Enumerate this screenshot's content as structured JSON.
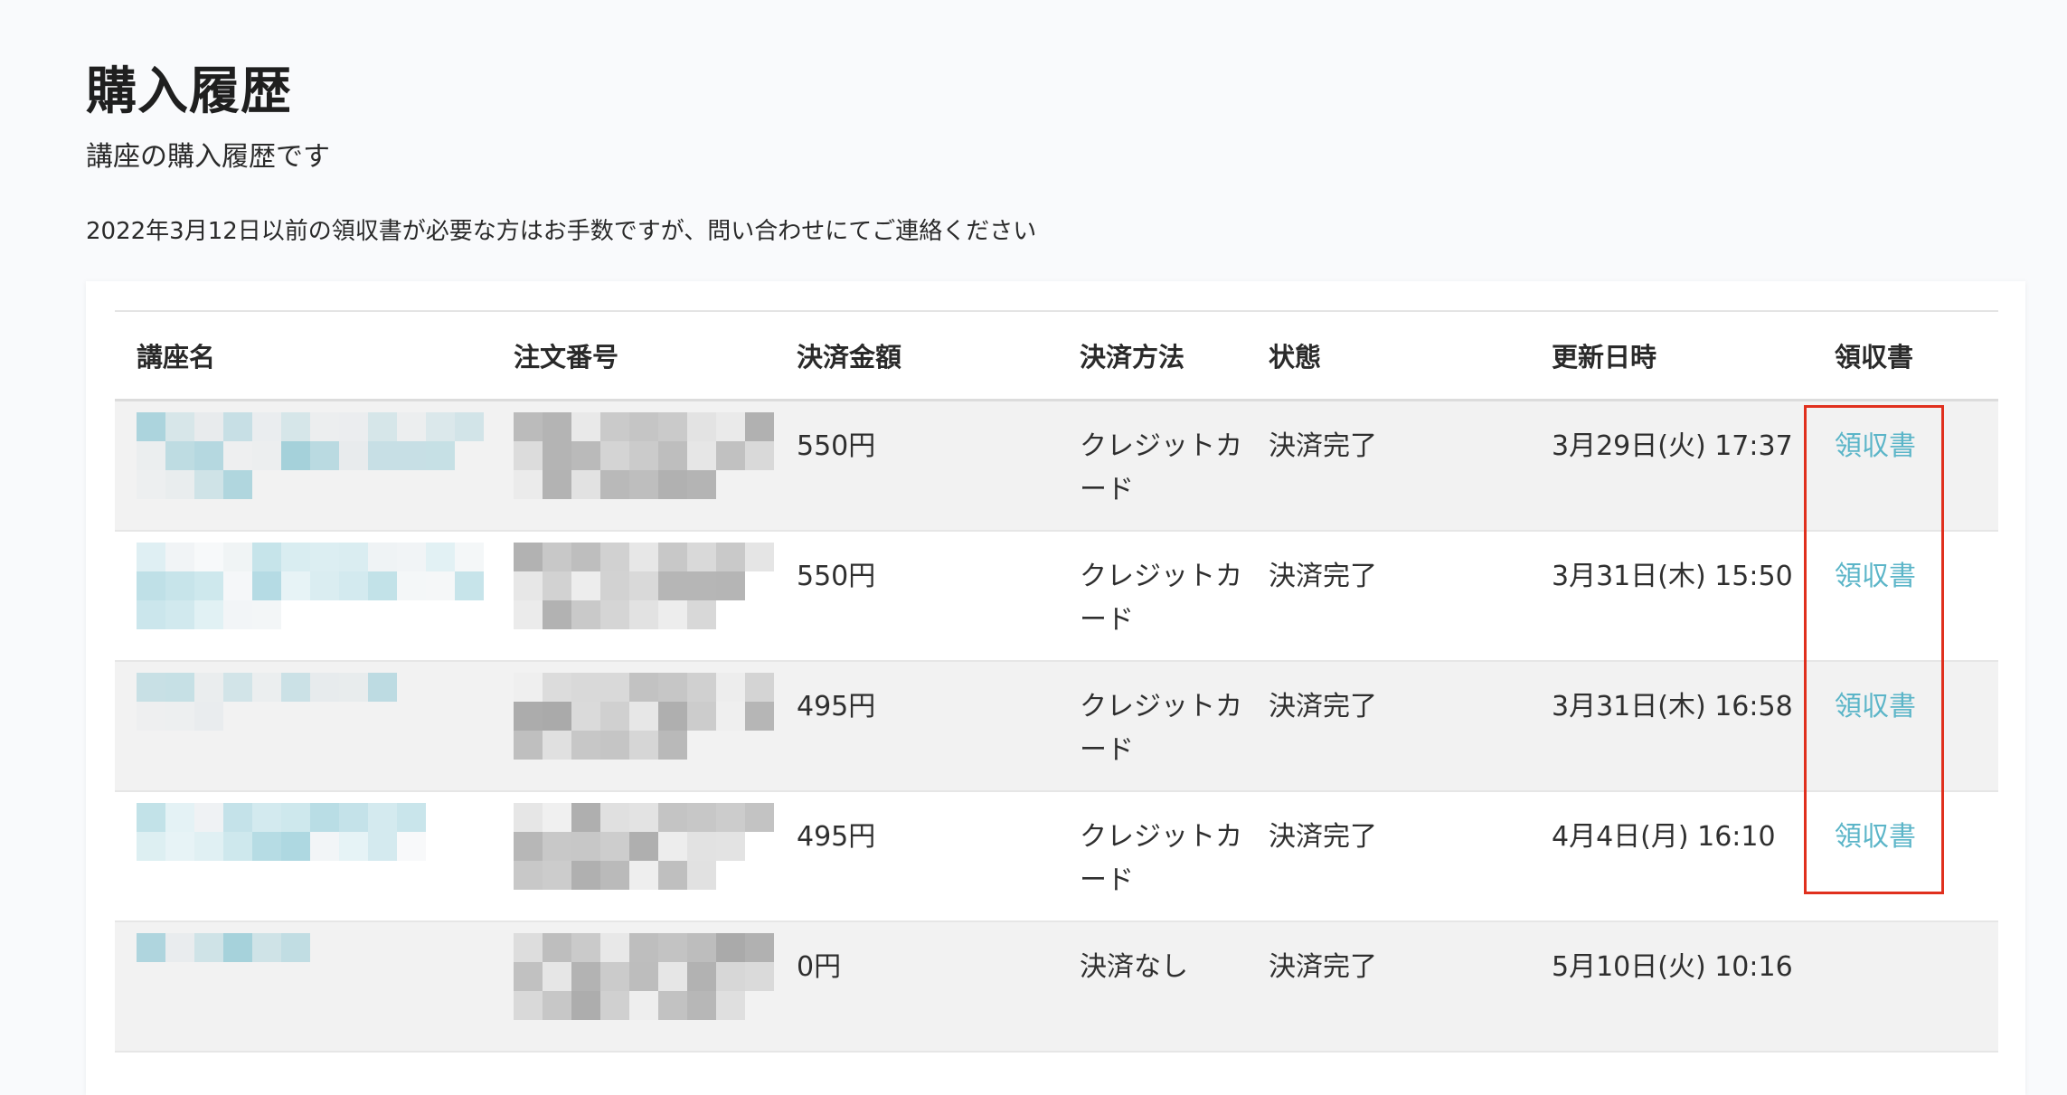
{
  "header": {
    "title": "購入履歴",
    "subtitle": "講座の購入履歴です",
    "notice": "2022年3月12日以前の領収書が必要な方はお手数ですが、問い合わせにてご連絡ください"
  },
  "table": {
    "columns": [
      "講座名",
      "注文番号",
      "決済金額",
      "決済方法",
      "状態",
      "更新日時",
      "領収書"
    ],
    "rows": [
      {
        "course": "",
        "order": "",
        "amount": "550円",
        "method": "クレジットカード",
        "status": "決済完了",
        "updated": "3月29日(火) 17:37",
        "receipt": "領収書"
      },
      {
        "course": "",
        "order": "",
        "amount": "550円",
        "method": "クレジットカード",
        "status": "決済完了",
        "updated": "3月31日(木) 15:50",
        "receipt": "領収書"
      },
      {
        "course": "",
        "order": "",
        "amount": "495円",
        "method": "クレジットカード",
        "status": "決済完了",
        "updated": "3月31日(木) 16:58",
        "receipt": "領収書"
      },
      {
        "course": "",
        "order": "",
        "amount": "495円",
        "method": "クレジットカード",
        "status": "決済完了",
        "updated": "4月4日(月) 16:10",
        "receipt": "領収書"
      },
      {
        "course": "",
        "order": "",
        "amount": "0円",
        "method": "決済なし",
        "status": "決済完了",
        "updated": "5月10日(火) 10:16",
        "receipt": ""
      }
    ]
  },
  "colors": {
    "link": "#5bb5c8",
    "highlight": "#e0301e",
    "row_stripe": "#f2f2f2"
  }
}
